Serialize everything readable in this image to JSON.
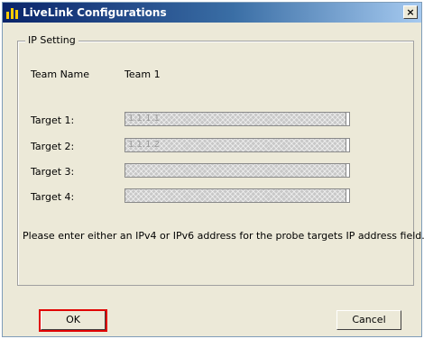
{
  "window": {
    "title": "LiveLink Configurations",
    "close_glyph": "×"
  },
  "ip_setting": {
    "legend": "IP Setting",
    "team_name_label": "Team Name",
    "team_name_value": "Team 1",
    "targets": [
      {
        "label": "Target 1:",
        "value": "1.1.1.1"
      },
      {
        "label": "Target 2:",
        "value": "1.1.1.2"
      },
      {
        "label": "Target 3:",
        "value": ""
      },
      {
        "label": "Target 4:",
        "value": ""
      }
    ],
    "hint": "Please enter either an IPv4 or IPv6 address for the probe targets IP address field."
  },
  "buttons": {
    "ok": "OK",
    "cancel": "Cancel"
  },
  "colors": {
    "highlight": "#e00000",
    "titlebar": "#0a246a"
  }
}
